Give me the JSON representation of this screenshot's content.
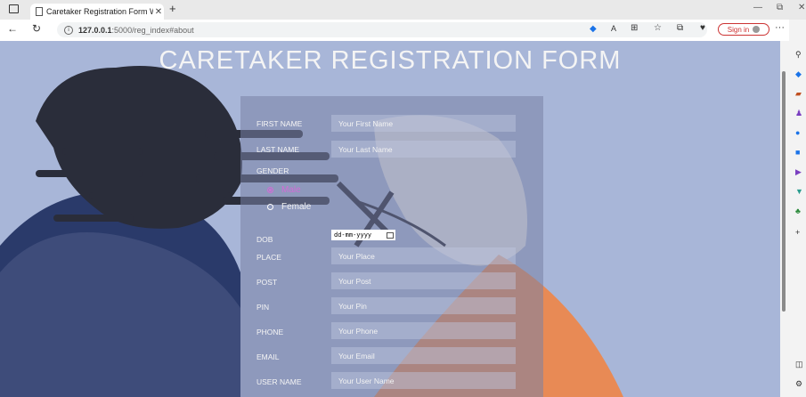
{
  "browser": {
    "tab_title": "Caretaker Registration Form We",
    "url_host": "127.0.0.1",
    "url_path": ":5000/reg_index#about",
    "sign_in_label": "Sign in",
    "reader_label": "A",
    "colors": {
      "sign_in": "#c33333",
      "edge_blue": "#1a73e8"
    }
  },
  "page": {
    "title": "CARETAKER REGISTRATION FORM",
    "colors": {
      "background": "#a8b6d8",
      "hair": "#2a2d3a",
      "skin_light": "#e8e8ea",
      "accent_orange": "#e88a55",
      "selected_radio": "#d26bd6"
    }
  },
  "form": {
    "first_name": {
      "label": "FIRST NAME",
      "placeholder": "Your First Name"
    },
    "last_name": {
      "label": "LAST NAME",
      "placeholder": "Your Last Name"
    },
    "gender": {
      "label": "GENDER",
      "options": [
        "Male",
        "Female"
      ],
      "selected": "Male"
    },
    "dob": {
      "label": "DOB",
      "placeholder": "dd-mm-yyyy"
    },
    "place": {
      "label": "PLACE",
      "placeholder": "Your Place"
    },
    "post": {
      "label": "POST",
      "placeholder": "Your Post"
    },
    "pin": {
      "label": "PIN",
      "placeholder": "Your Pin"
    },
    "phone": {
      "label": "PHONE",
      "placeholder": "Your Phone"
    },
    "email": {
      "label": "EMAIL",
      "placeholder": "Your Email"
    },
    "username": {
      "label": "USER NAME",
      "placeholder": "Your  User Name"
    }
  },
  "icons": [
    "tab-actions-icon",
    "page-icon",
    "close-icon",
    "new-tab-icon",
    "back-icon",
    "refresh-icon",
    "info-icon",
    "read-aloud-icon",
    "favorites-icon",
    "collections-icon",
    "sign-in-avatar-icon",
    "more-icon",
    "bing-icon",
    "minimize-icon",
    "window-icon",
    "calendar-icon",
    "search-icon",
    "add-icon",
    "sidebar-toggle-icon",
    "settings-icon"
  ]
}
